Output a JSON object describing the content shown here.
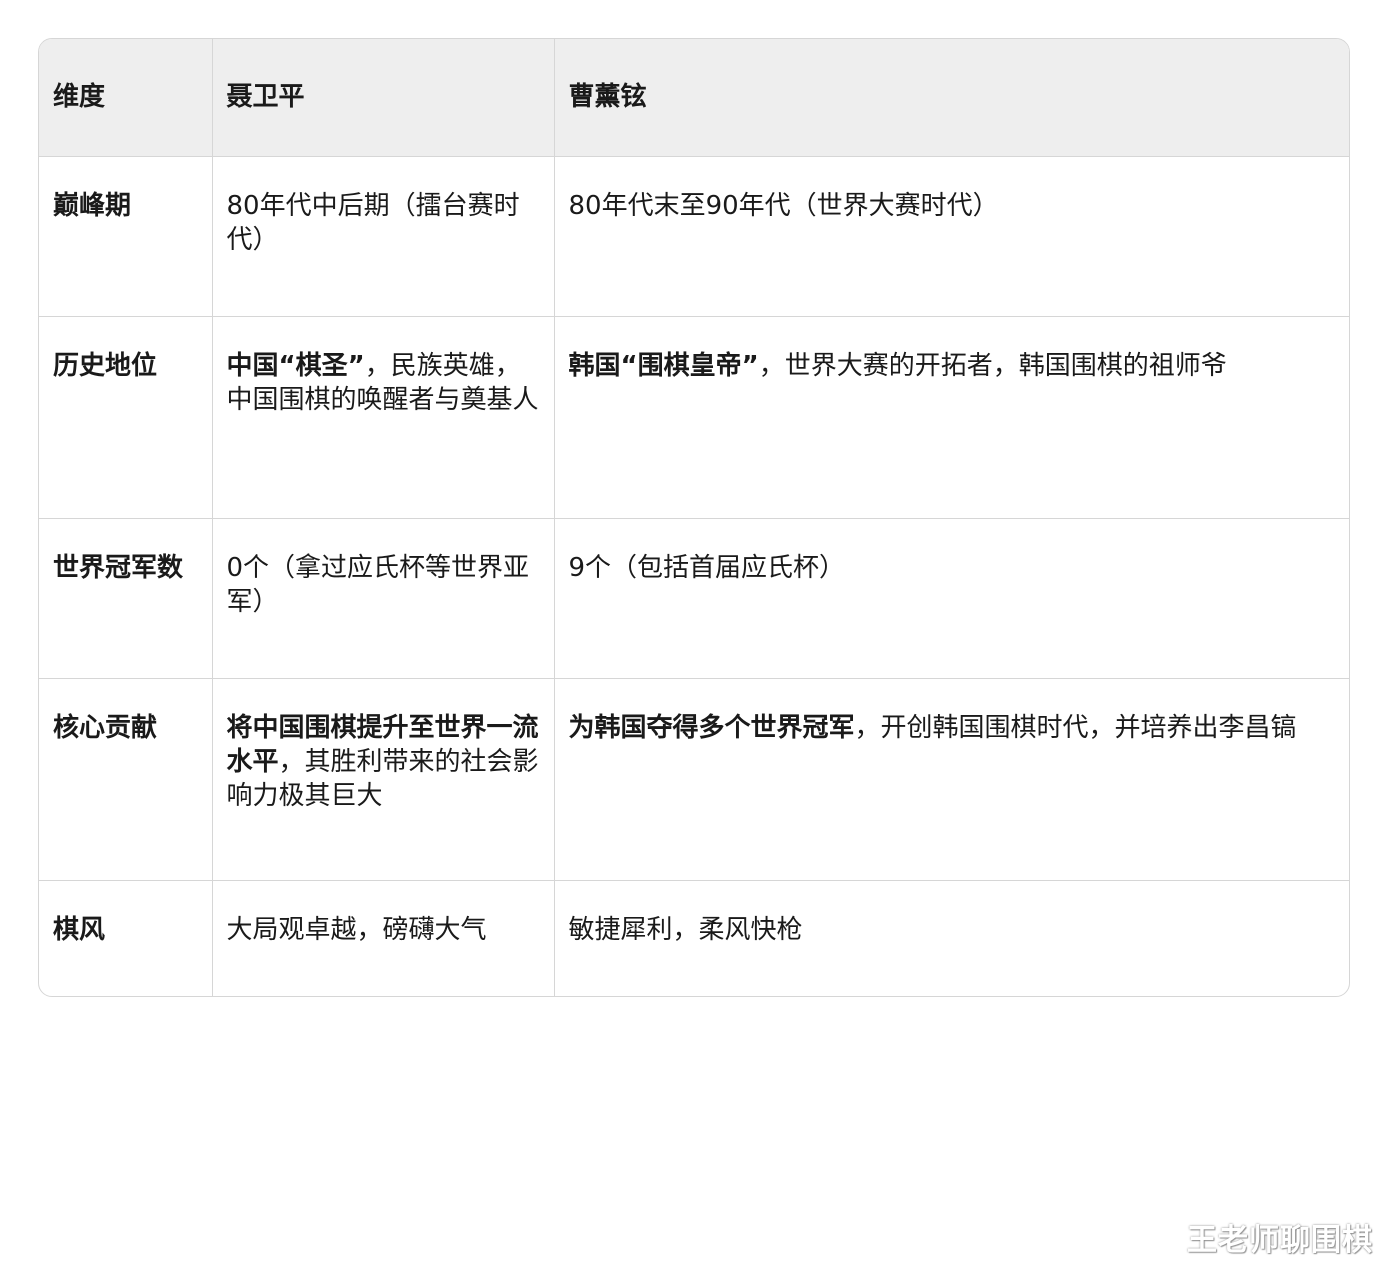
{
  "table": {
    "headers": [
      "维度",
      "聂卫平",
      "曹薰铉"
    ],
    "rows": [
      {
        "dimension": "巅峰期",
        "nie": {
          "bold": "",
          "text": "80年代中后期（擂台赛时代）"
        },
        "cho": {
          "bold": "",
          "text": "80年代末至90年代（世界大赛时代）"
        }
      },
      {
        "dimension": "历史地位",
        "nie": {
          "bold": "中国“棋圣”",
          "text": "，民族英雄，中国围棋的唤醒者与奠基人"
        },
        "cho": {
          "bold": "韩国“围棋皇帝”",
          "text": "，世界大赛的开拓者，韩国围棋的祖师爷"
        }
      },
      {
        "dimension": "世界冠军数",
        "nie": {
          "bold": "",
          "text": "0个（拿过应氏杯等世界亚军）"
        },
        "cho": {
          "bold": "",
          "text": "9个（包括首届应氏杯）"
        }
      },
      {
        "dimension": "核心贡献",
        "nie": {
          "bold": "将中国围棋提升至世界一流水平",
          "text": "，其胜利带来的社会影响力极其巨大"
        },
        "cho": {
          "bold": "为韩国夺得多个世界冠军",
          "text": "，开创韩国围棋时代，并培养出李昌镐"
        }
      },
      {
        "dimension": "棋风",
        "nie": {
          "bold": "",
          "text": "大局观卓越，磅礴大气"
        },
        "cho": {
          "bold": "",
          "text": "敏捷犀利，柔风快枪"
        }
      }
    ]
  },
  "watermark": "王老师聊围棋"
}
